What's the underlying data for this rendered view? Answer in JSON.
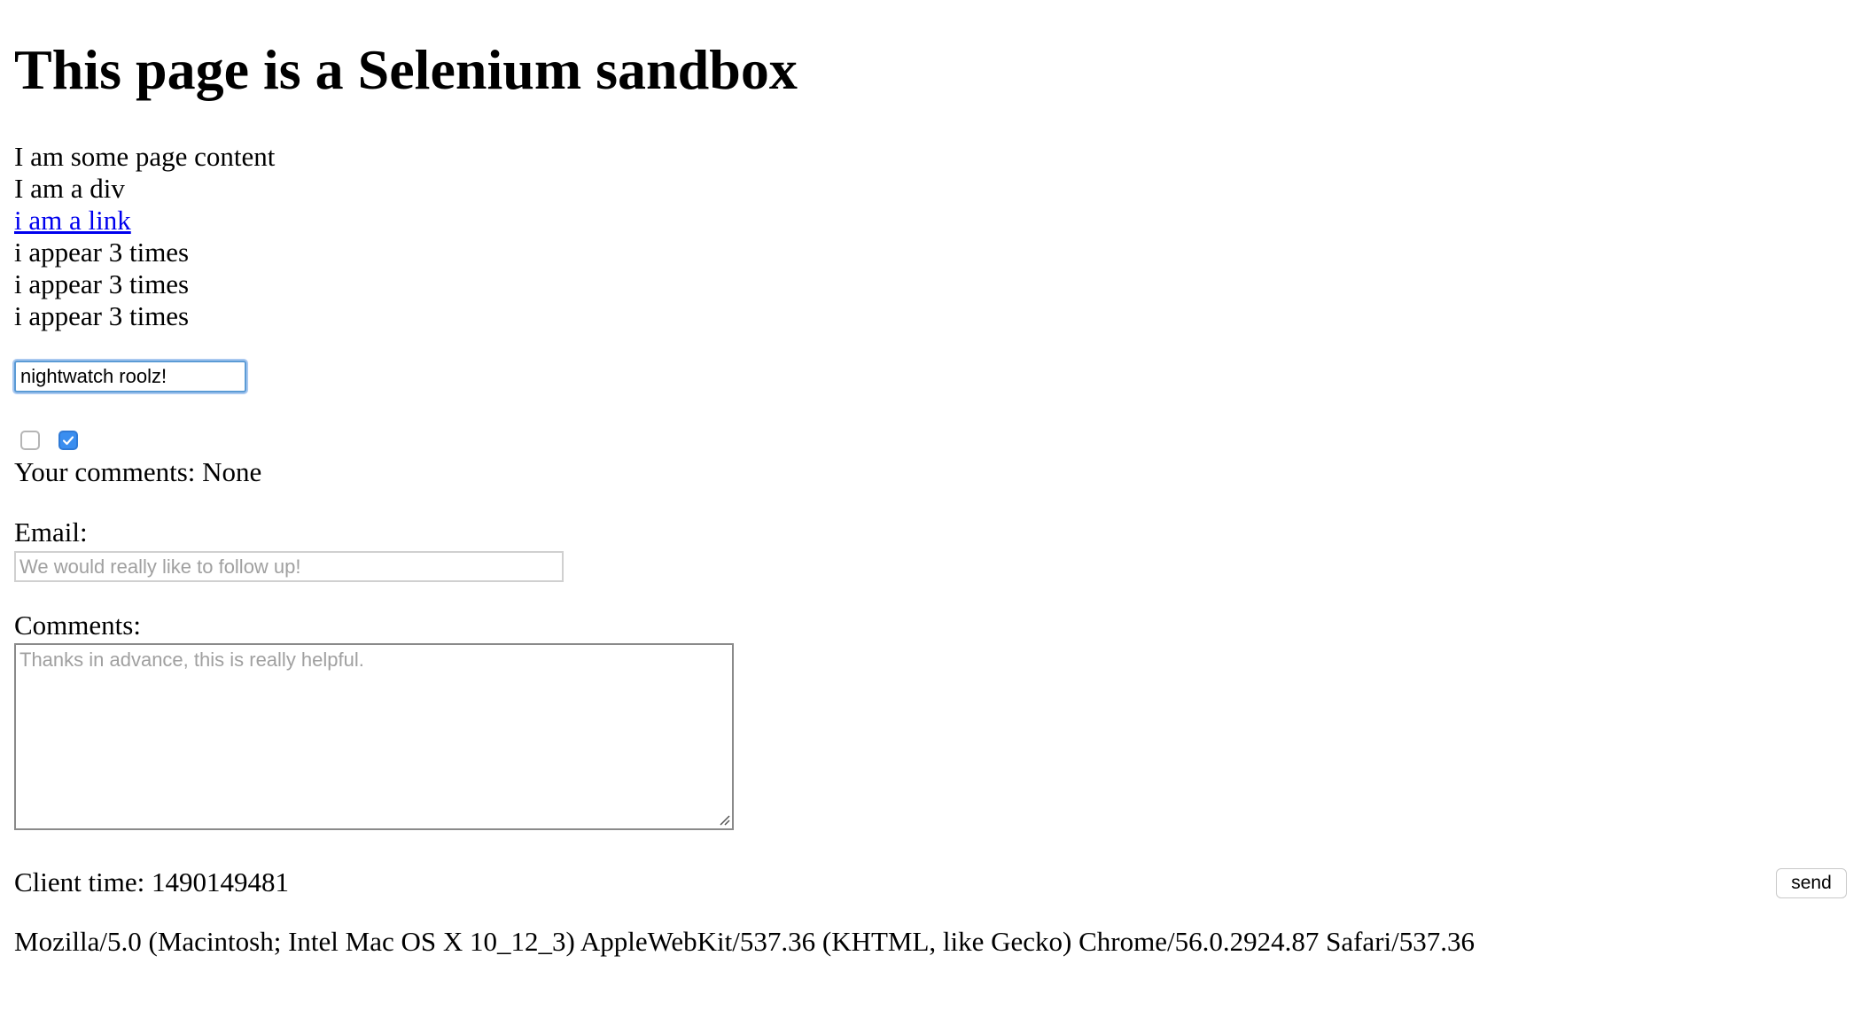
{
  "page": {
    "heading": "This page is a Selenium sandbox",
    "content_line": "I am some page content",
    "div_line": "I am a div",
    "link_text": "i am a link",
    "repeated_lines": [
      "i appear 3 times",
      "i appear 3 times",
      "i appear 3 times"
    ]
  },
  "text_input": {
    "value": "nightwatch roolz!"
  },
  "checkboxes": [
    {
      "checked": false
    },
    {
      "checked": true
    }
  ],
  "comments_status": "Your comments: None",
  "email": {
    "label": "Email:",
    "placeholder": "We would really like to follow up!"
  },
  "comments": {
    "label": "Comments:",
    "placeholder": "Thanks in advance, this is really helpful."
  },
  "client_time": "Client time: 1490149481",
  "send_button": "send",
  "user_agent": "Mozilla/5.0 (Macintosh; Intel Mac OS X 10_12_3) AppleWebKit/537.36 (KHTML, like Gecko) Chrome/56.0.2924.87 Safari/537.36",
  "colors": {
    "link": "#0000ee",
    "checkbox_checked": "#3a8ef0",
    "focus_ring": "#5b9bd5"
  }
}
